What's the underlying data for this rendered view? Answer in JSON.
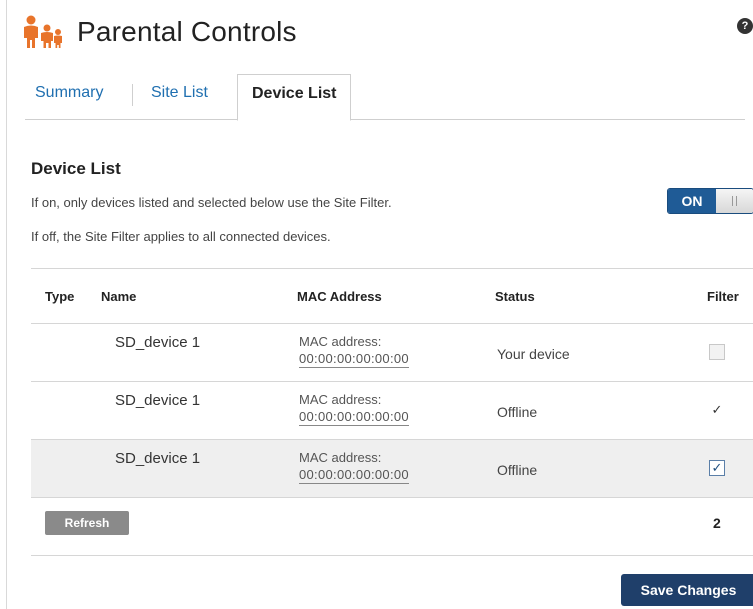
{
  "header": {
    "title": "Parental Controls",
    "help_icon": "question-circle-icon",
    "help_symbol": "?"
  },
  "tabs": [
    {
      "label": "Summary",
      "active": false
    },
    {
      "label": "Site List",
      "active": false
    },
    {
      "label": "Device List",
      "active": true
    }
  ],
  "section": {
    "title": "Device List",
    "desc_on": "If on, only devices listed and selected below use the Site Filter.",
    "desc_off": "If off, the Site Filter applies to all connected devices.",
    "toggle_label": "ON",
    "toggle_state": "on"
  },
  "table": {
    "headers": [
      "Type",
      "Name",
      "MAC Address",
      "Status",
      "Filter"
    ],
    "rows": [
      {
        "name": "SD_device 1",
        "mac_label": "MAC address:",
        "mac": "00:00:00:00:00:00",
        "status": "Your device",
        "filter": false,
        "check_symbol": ""
      },
      {
        "name": "SD_device 1",
        "mac_label": "MAC address:",
        "mac": "00:00:00:00:00:00",
        "status": "Offline",
        "filter": true,
        "check_symbol": "✓"
      },
      {
        "name": "SD_device 1",
        "mac_label": "MAC address:",
        "mac": "00:00:00:00:00:00",
        "status": "Offline",
        "filter": true,
        "check_symbol": "✓"
      }
    ],
    "refresh_label": "Refresh",
    "selected_count": "2"
  },
  "save_label": "Save Changes",
  "colors": {
    "tab_link": "#1f6fb0",
    "toggle_on": "#1f5b96",
    "save_button": "#1f3f6a",
    "refresh_button": "#8a8a8a",
    "logo": "#e8742b"
  }
}
